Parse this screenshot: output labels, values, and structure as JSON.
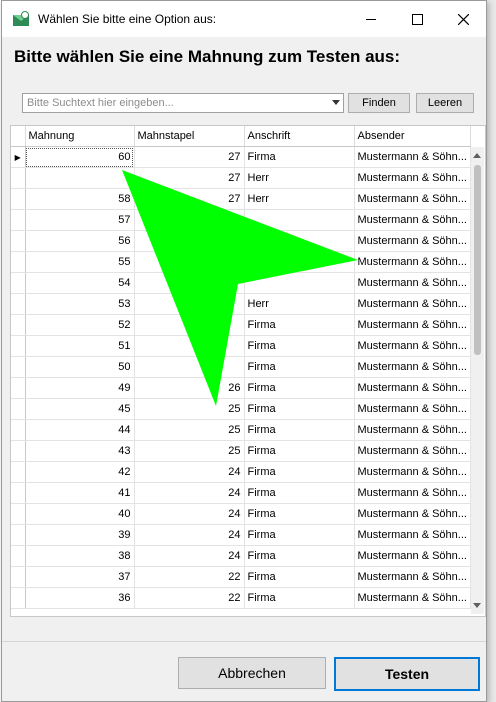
{
  "window": {
    "title": "Wählen Sie bitte eine Option aus:",
    "heading": "Bitte wählen Sie eine Mahnung zum Testen aus:"
  },
  "search": {
    "placeholder": "Bitte Suchtext hier eingeben...",
    "find_label": "Finden",
    "clear_label": "Leeren"
  },
  "grid": {
    "columns": [
      "Mahnung",
      "Mahnstapel",
      "Anschrift",
      "Absender"
    ],
    "rows": [
      {
        "mahnung": "60",
        "stapel": "27",
        "anschrift": "Firma",
        "absender": "Mustermann & Söhn..."
      },
      {
        "mahnung": "",
        "stapel": "27",
        "anschrift": "Herr",
        "absender": "Mustermann & Söhn..."
      },
      {
        "mahnung": "58",
        "stapel": "27",
        "anschrift": "Herr",
        "absender": "Mustermann & Söhn..."
      },
      {
        "mahnung": "57",
        "stapel": "",
        "anschrift": "",
        "absender": "Mustermann & Söhn..."
      },
      {
        "mahnung": "56",
        "stapel": "",
        "anschrift": "",
        "absender": "Mustermann & Söhn..."
      },
      {
        "mahnung": "55",
        "stapel": "",
        "anschrift": "",
        "absender": "Mustermann & Söhn..."
      },
      {
        "mahnung": "54",
        "stapel": "",
        "anschrift": "",
        "absender": "Mustermann & Söhn..."
      },
      {
        "mahnung": "53",
        "stapel": "",
        "anschrift": "Herr",
        "absender": "Mustermann & Söhn..."
      },
      {
        "mahnung": "52",
        "stapel": "",
        "anschrift": "Firma",
        "absender": "Mustermann & Söhn..."
      },
      {
        "mahnung": "51",
        "stapel": "",
        "anschrift": "Firma",
        "absender": "Mustermann & Söhn..."
      },
      {
        "mahnung": "50",
        "stapel": "",
        "anschrift": "Firma",
        "absender": "Mustermann & Söhn..."
      },
      {
        "mahnung": "49",
        "stapel": "26",
        "anschrift": "Firma",
        "absender": "Mustermann & Söhn..."
      },
      {
        "mahnung": "45",
        "stapel": "25",
        "anschrift": "Firma",
        "absender": "Mustermann & Söhn..."
      },
      {
        "mahnung": "44",
        "stapel": "25",
        "anschrift": "Firma",
        "absender": "Mustermann & Söhn..."
      },
      {
        "mahnung": "43",
        "stapel": "25",
        "anschrift": "Firma",
        "absender": "Mustermann & Söhn..."
      },
      {
        "mahnung": "42",
        "stapel": "24",
        "anschrift": "Firma",
        "absender": "Mustermann & Söhn..."
      },
      {
        "mahnung": "41",
        "stapel": "24",
        "anschrift": "Firma",
        "absender": "Mustermann & Söhn..."
      },
      {
        "mahnung": "40",
        "stapel": "24",
        "anschrift": "Firma",
        "absender": "Mustermann & Söhn..."
      },
      {
        "mahnung": "39",
        "stapel": "24",
        "anschrift": "Firma",
        "absender": "Mustermann & Söhn..."
      },
      {
        "mahnung": "38",
        "stapel": "24",
        "anschrift": "Firma",
        "absender": "Mustermann & Söhn..."
      },
      {
        "mahnung": "37",
        "stapel": "22",
        "anschrift": "Firma",
        "absender": "Mustermann & Söhn..."
      },
      {
        "mahnung": "36",
        "stapel": "22",
        "anschrift": "Firma",
        "absender": "Mustermann & Söhn..."
      }
    ]
  },
  "footer": {
    "cancel_label": "Abbrechen",
    "ok_label": "Testen"
  },
  "colors": {
    "accent": "#0078d7",
    "cursor": "#00ff00"
  },
  "icons": [
    "app-mail-icon",
    "minimize-icon",
    "maximize-icon",
    "close-icon",
    "dropdown-arrow-icon",
    "row-indicator-icon",
    "scroll-up-icon",
    "scroll-down-icon"
  ]
}
